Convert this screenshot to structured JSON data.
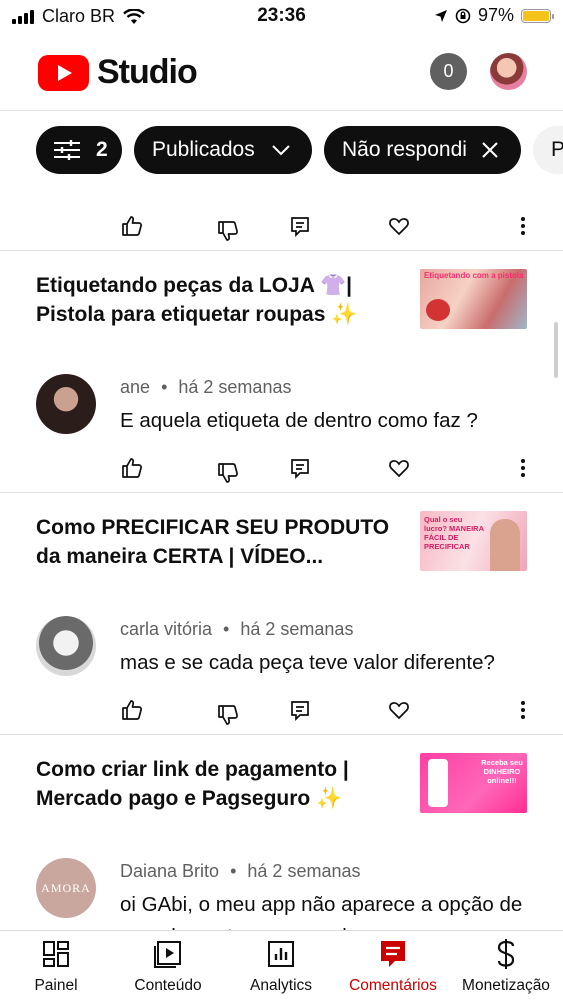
{
  "status_bar": {
    "carrier": "Claro BR",
    "time": "23:36",
    "battery": "97%"
  },
  "app": {
    "title": "Studio",
    "notification_count": "0"
  },
  "filters": {
    "filter_count": "2",
    "chips": [
      "Publicados",
      "Não respondi",
      "P"
    ]
  },
  "posts": [
    {
      "video_title": "Etiquetando peças da LOJA 👚| Pistola para etiquetar roupas ✨",
      "author": "ane",
      "time": "há 2 semanas",
      "comment": "E aquela etiqueta de dentro como faz ?"
    },
    {
      "video_title": "Como PRECIFICAR SEU PRODUTO da maneira CERTA | VÍDEO...",
      "author": "carla vitória",
      "time": "há 2 semanas",
      "comment": "mas e se cada peça teve valor diferente?"
    },
    {
      "video_title": "Como criar link de pagamento | Mercado pago e Pagseguro ✨",
      "author": "Daiana Brito",
      "time": "há 2 semanas",
      "comment": "oi GAbi,  o meu app não aparece a opção de parcelamento p comprador, aparece"
    }
  ],
  "thumbnails": {
    "thumb1_text": "Etiquetando com a pistola",
    "thumb2_text": "Qual o seu lucro? MANEIRA FÁCIL DE PRECIFICAR",
    "thumb3_text": "Receba seu DINHEIRO online!!!"
  },
  "avatar_text": {
    "daiana": "AMORA"
  },
  "bottom_nav": [
    {
      "label": "Painel",
      "icon": "dashboard-icon"
    },
    {
      "label": "Conteúdo",
      "icon": "content-icon"
    },
    {
      "label": "Analytics",
      "icon": "analytics-icon"
    },
    {
      "label": "Comentários",
      "icon": "comments-icon",
      "active": true
    },
    {
      "label": "Monetização",
      "icon": "monetization-icon"
    }
  ],
  "colors": {
    "accent": "#ff0000",
    "active_nav": "#cc0000",
    "chip_dark": "#0f0f0f"
  }
}
